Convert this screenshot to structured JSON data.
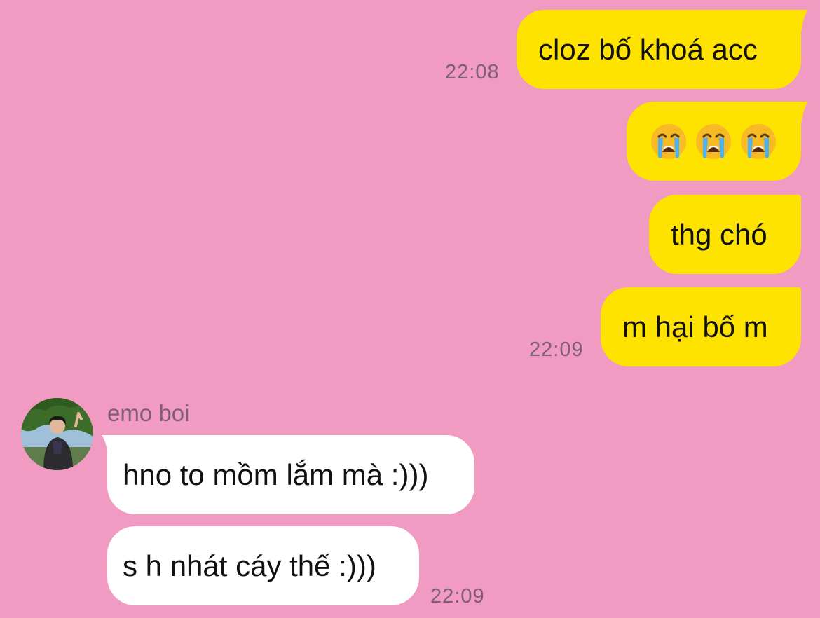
{
  "colors": {
    "background": "#f29bc2",
    "outgoing_bubble": "#ffe300",
    "incoming_bubble": "#ffffff",
    "timestamp": "#7f5e78"
  },
  "messages": {
    "m1": {
      "text": "cloz bố khoá acc",
      "time": "22:08"
    },
    "m2": {
      "emojis": [
        "loudly-crying-face",
        "loudly-crying-face",
        "loudly-crying-face"
      ]
    },
    "m3": {
      "text": "thg chó"
    },
    "m4": {
      "text": "m hại bố m",
      "time": "22:09"
    },
    "incoming": {
      "sender": "emo boi",
      "avatar_icon": "profile-photo-avatar",
      "m5": {
        "text": "hno to mồm lắm mà :)))"
      },
      "m6": {
        "text": "s h nhát cáy thế :)))",
        "time": "22:09"
      }
    }
  }
}
